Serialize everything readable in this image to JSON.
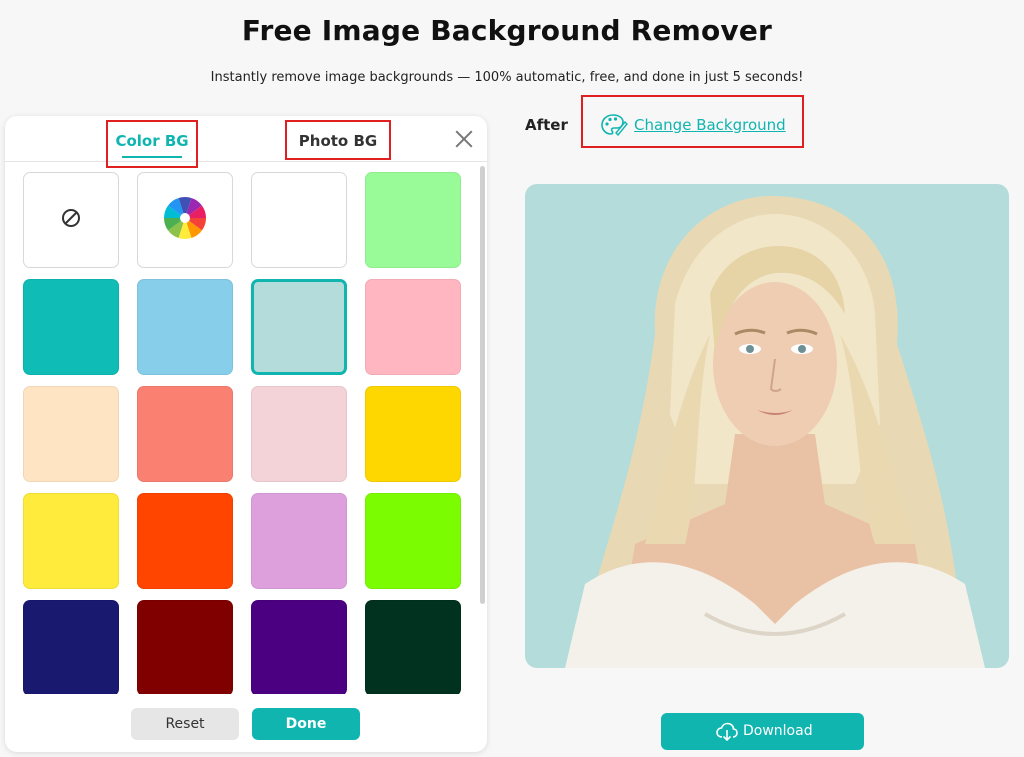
{
  "header": {
    "title": "Free Image Background Remover",
    "subtitle": "Instantly remove image backgrounds — 100% automatic, free, and done in just 5 seconds!"
  },
  "panel": {
    "tabs": [
      {
        "label": "Color BG",
        "active": true
      },
      {
        "label": "Photo BG",
        "active": false
      }
    ],
    "swatches": [
      {
        "type": "none",
        "icon": "no-background-icon"
      },
      {
        "type": "picker",
        "icon": "color-wheel-icon"
      },
      {
        "type": "color",
        "color": "#ffffff"
      },
      {
        "type": "color",
        "color": "#98fb98"
      },
      {
        "type": "color",
        "color": "#0fbcb6"
      },
      {
        "type": "color",
        "color": "#87ceeb"
      },
      {
        "type": "color",
        "color": "#b3dcdb",
        "selected": true
      },
      {
        "type": "color",
        "color": "#ffb6c1"
      },
      {
        "type": "color",
        "color": "#ffe4c4"
      },
      {
        "type": "color",
        "color": "#fa8072"
      },
      {
        "type": "color",
        "color": "#f4d3d8"
      },
      {
        "type": "color",
        "color": "#ffd700"
      },
      {
        "type": "color",
        "color": "#ffeb3b"
      },
      {
        "type": "color",
        "color": "#ff4500"
      },
      {
        "type": "color",
        "color": "#dda0dd"
      },
      {
        "type": "color",
        "color": "#7cfc00"
      },
      {
        "type": "color",
        "color": "#191970"
      },
      {
        "type": "color",
        "color": "#800000"
      },
      {
        "type": "color",
        "color": "#4b0082"
      },
      {
        "type": "color",
        "color": "#013220"
      }
    ],
    "reset_label": "Reset",
    "done_label": "Done"
  },
  "result": {
    "after_label": "After",
    "change_background_label": "Change Background",
    "background_color": "#b3dcdb",
    "download_label": "Download"
  },
  "colors": {
    "accent": "#10b5b0",
    "highlight_box": "#e02020"
  }
}
